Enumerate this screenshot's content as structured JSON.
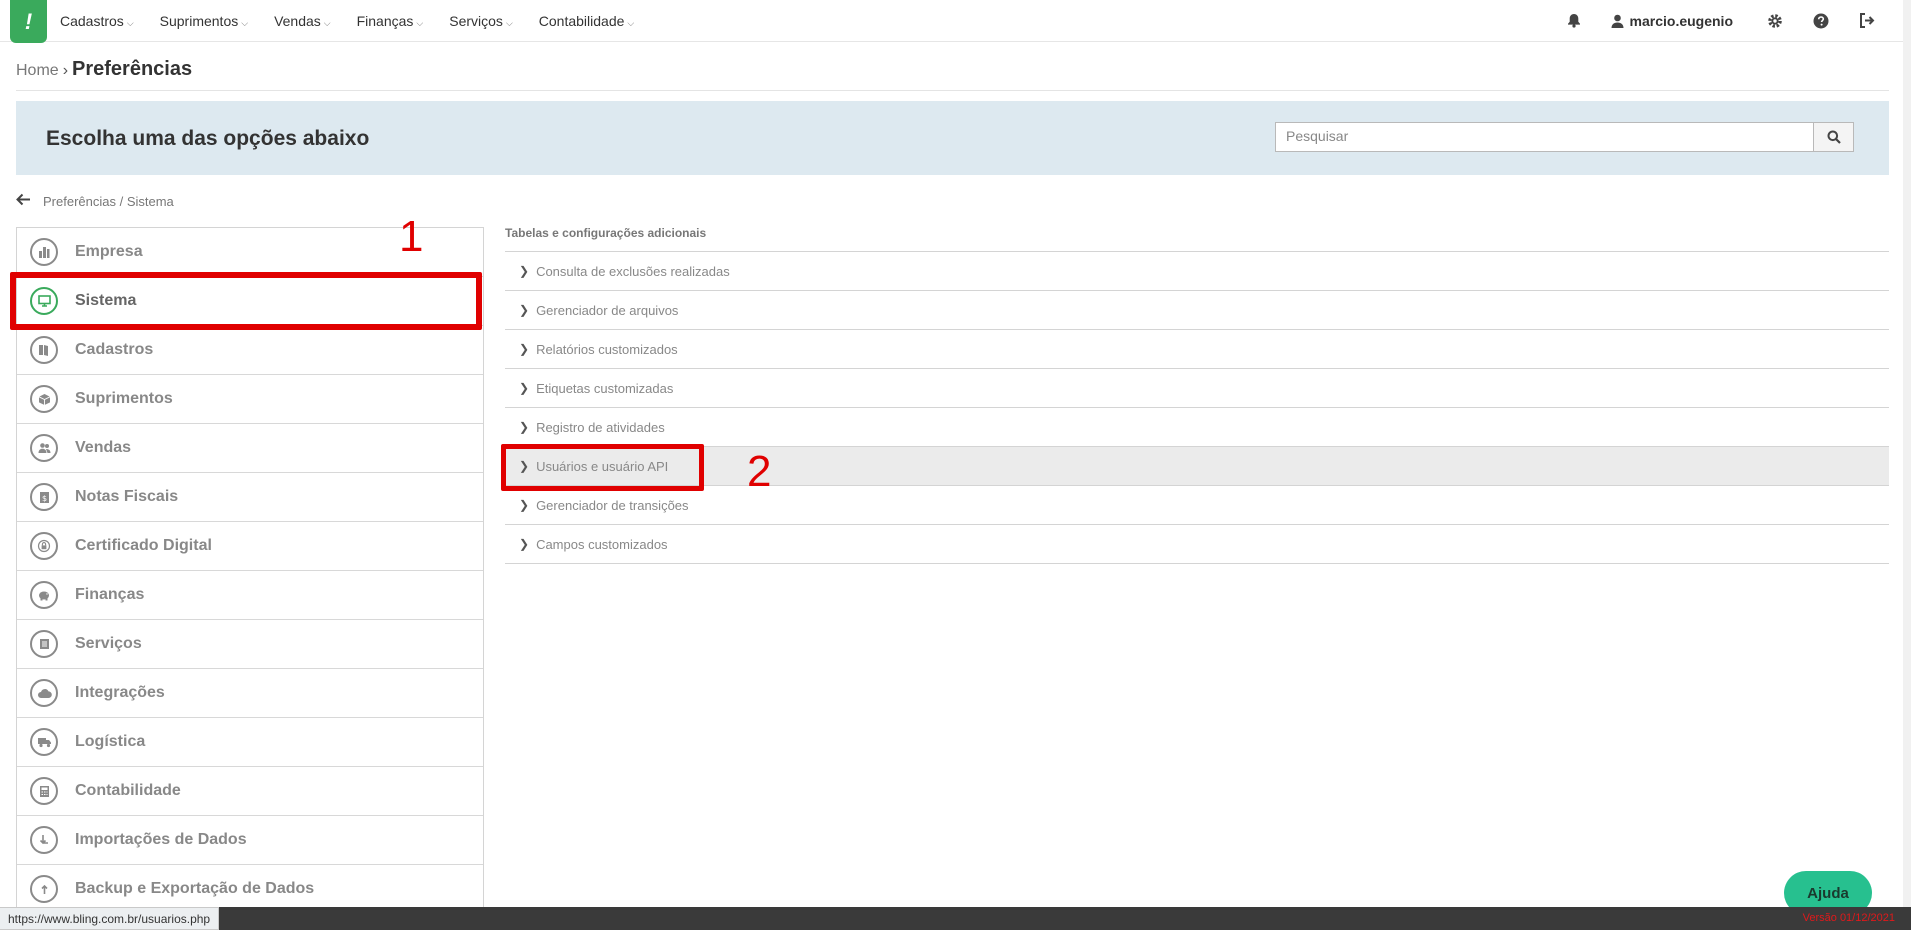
{
  "topnav": {
    "logo_text": "!",
    "menu": [
      {
        "label": "Cadastros"
      },
      {
        "label": "Suprimentos"
      },
      {
        "label": "Vendas"
      },
      {
        "label": "Finanças"
      },
      {
        "label": "Serviços"
      },
      {
        "label": "Contabilidade"
      }
    ],
    "username": "marcio.eugenio"
  },
  "breadcrumb": {
    "home": "Home",
    "current": "Preferências"
  },
  "banner": {
    "title": "Escolha uma das opções abaixo",
    "search_placeholder": "Pesquisar"
  },
  "backpath": {
    "text": "Preferências / Sistema"
  },
  "sidebar": {
    "items": [
      {
        "label": "Empresa",
        "icon": "building-icon"
      },
      {
        "label": "Sistema",
        "icon": "monitor-icon",
        "active": true
      },
      {
        "label": "Cadastros",
        "icon": "book-icon"
      },
      {
        "label": "Suprimentos",
        "icon": "box-icon"
      },
      {
        "label": "Vendas",
        "icon": "users-icon"
      },
      {
        "label": "Notas Fiscais",
        "icon": "invoice-icon"
      },
      {
        "label": "Certificado Digital",
        "icon": "lock-icon"
      },
      {
        "label": "Finanças",
        "icon": "piggy-bank-icon"
      },
      {
        "label": "Serviços",
        "icon": "document-icon"
      },
      {
        "label": "Integrações",
        "icon": "cloud-icon"
      },
      {
        "label": "Logística",
        "icon": "truck-icon"
      },
      {
        "label": "Contabilidade",
        "icon": "calculator-icon"
      },
      {
        "label": "Importações de Dados",
        "icon": "import-icon"
      },
      {
        "label": "Backup e Exportação de Dados",
        "icon": "export-icon"
      }
    ]
  },
  "panel": {
    "section_title": "Tabelas e configurações adicionais",
    "options": [
      {
        "label": "Consulta de exclusões realizadas"
      },
      {
        "label": "Gerenciador de arquivos"
      },
      {
        "label": "Relatórios customizados"
      },
      {
        "label": "Etiquetas customizadas"
      },
      {
        "label": "Registro de atividades"
      },
      {
        "label": "Usuários e usuário API",
        "hover": true
      },
      {
        "label": "Gerenciador de transições"
      },
      {
        "label": "Campos customizados"
      }
    ]
  },
  "annotations": {
    "mark1": "1",
    "mark2": "2"
  },
  "status": {
    "url": "https://www.bling.com.br/usuarios.php",
    "version": "Versão 01/12/2021"
  },
  "help": {
    "label": "Ajuda"
  },
  "colors": {
    "brand": "#3aaa5c",
    "annotation": "#e00000",
    "help": "#27c08f",
    "banner": "#dde9f0"
  }
}
